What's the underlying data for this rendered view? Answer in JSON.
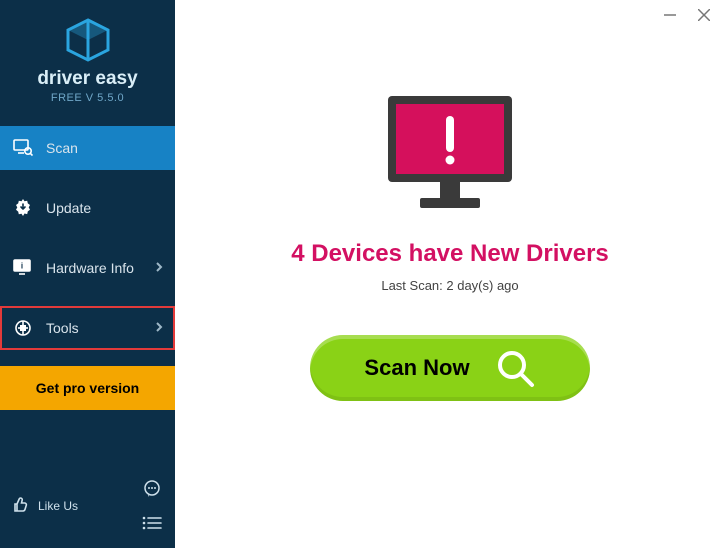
{
  "window": {
    "minimize": "—",
    "close": "×"
  },
  "brand": {
    "name": "driver easy",
    "sub": "FREE V 5.5.0"
  },
  "sidebar": {
    "scan": "Scan",
    "update": "Update",
    "hardware": "Hardware Info",
    "tools": "Tools",
    "pro": "Get pro version",
    "like": "Like Us"
  },
  "main": {
    "headline": "4 Devices have New Drivers",
    "last_scan": "Last Scan: 2 day(s) ago",
    "scan_now": "Scan Now"
  },
  "colors": {
    "sidebar_bg": "#0c2f48",
    "active_bg": "#1782c5",
    "pro_bg": "#f4a600",
    "highlight_border": "#e23a3a",
    "headline": "#d31062",
    "scan_btn": "#8ad216",
    "monitor_screen": "#d5105c"
  }
}
